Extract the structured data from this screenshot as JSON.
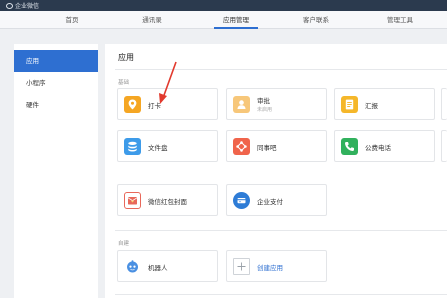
{
  "topbar": {
    "brand": "企业微信"
  },
  "nav": {
    "tabs": [
      "首页",
      "通讯录",
      "应用管理",
      "客户联系",
      "管理工具"
    ],
    "active": 2
  },
  "sidebar": {
    "items": [
      "应用",
      "小程序",
      "硬件"
    ],
    "active": 0
  },
  "main": {
    "title": "应用",
    "section_basic": "基础",
    "section_custom": "自建",
    "apps": {
      "daka": {
        "name": "打卡",
        "icon": "location-pin-icon"
      },
      "shenpi": {
        "name": "审批",
        "sub": "未启用",
        "icon": "approval-user-icon"
      },
      "huibao": {
        "name": "汇报",
        "icon": "report-document-icon"
      },
      "wenjianpan": {
        "name": "文件盘",
        "icon": "database-disk-icon"
      },
      "tongshiba": {
        "name": "同事吧",
        "icon": "network-nodes-icon"
      },
      "gongfei": {
        "name": "公费电话",
        "icon": "phone-icon"
      },
      "hongbao": {
        "name": "微信红包封面",
        "icon": "red-envelope-icon"
      },
      "zhifu": {
        "name": "企业支付",
        "icon": "payment-icon"
      },
      "jiqiren": {
        "name": "机器人",
        "icon": "robot-icon"
      },
      "chuangjian": {
        "name": "创建应用",
        "icon": "plus-icon"
      }
    }
  },
  "colors": {
    "topbar": "#2b3a4e",
    "accent": "#2e6fd1",
    "daka": "#f5a623",
    "shenpi": "#f7c77a",
    "huibao": "#f5b72a",
    "wenjianpan": "#3d9be9",
    "tongshiba": "#f0644b",
    "gongfei": "#31b15d",
    "hongbao": "#e8685a",
    "zhifu": "#2e7cd6",
    "jiqiren": "#4a90e2"
  }
}
